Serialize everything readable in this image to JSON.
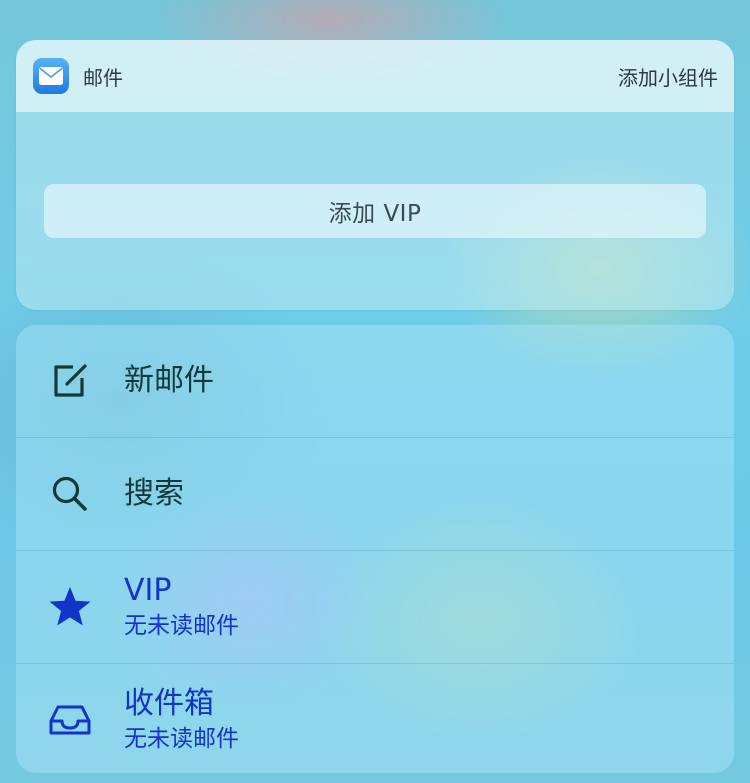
{
  "widget": {
    "app_icon": "mail-envelope-icon",
    "app_name": "邮件",
    "add_widget_label": "添加小组件",
    "add_vip_label": "添加 VIP"
  },
  "menu": {
    "items": [
      {
        "icon": "compose-icon",
        "title": "新邮件",
        "subtitle": ""
      },
      {
        "icon": "search-icon",
        "title": "搜索",
        "subtitle": ""
      },
      {
        "icon": "star-icon",
        "title": "VIP",
        "subtitle": "无未读邮件"
      },
      {
        "icon": "inbox-tray-icon",
        "title": "收件箱",
        "subtitle": "无未读邮件"
      }
    ]
  },
  "colors": {
    "primary_text": "#14393a",
    "accent_blue": "#1234c8",
    "mail_icon_top": "#56b3f5",
    "mail_icon_bottom": "#1e7be0"
  }
}
